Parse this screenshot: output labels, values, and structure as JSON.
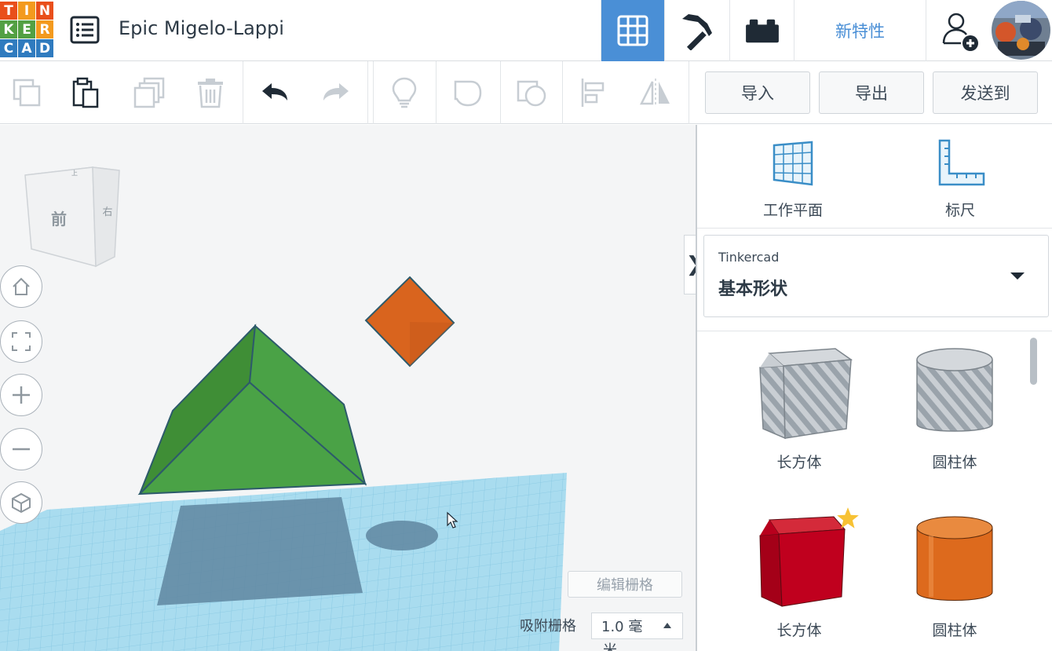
{
  "header": {
    "logo_letters": [
      "T",
      "I",
      "N",
      "K",
      "E",
      "R",
      "C",
      "A",
      "D"
    ],
    "logo_colors": [
      "#e94f1b",
      "#f39a1e",
      "#e94f1b",
      "#52a043",
      "#52a043",
      "#f39a1e",
      "#2f7bbf",
      "#2f7bbf",
      "#2f7bbf"
    ],
    "doc_title": "Epic Migelo-Lappi",
    "whats_new_label": "新特性",
    "tabs": [
      "3d-design-grid",
      "blocks-pickaxe",
      "bricks"
    ]
  },
  "toolbar": {
    "import_label": "导入",
    "export_label": "导出",
    "send_to_label": "发送到"
  },
  "viewport": {
    "view_cube_front": "前",
    "view_cube_right": "右",
    "view_cube_top": "上",
    "edit_grid_label": "编辑栅格",
    "snap_grid_label": "吸附栅格",
    "snap_value": "1.0 毫",
    "snap_value_wrap": "米",
    "collapse_label": "❯"
  },
  "panel": {
    "workplane_label": "工作平面",
    "ruler_label": "标尺",
    "library_source": "Tinkercad",
    "library_name": "基本形状",
    "shapes": [
      {
        "label": "长方体"
      },
      {
        "label": "圆柱体"
      },
      {
        "label": "长方体"
      },
      {
        "label": "圆柱体"
      }
    ]
  },
  "colors": {
    "accent": "#4a8fd6",
    "roof_green": "#4a9e3f",
    "box_orange": "#d9641e",
    "box_red": "#c0001e",
    "cylinder_orange": "#dd6a1d",
    "grid_blue": "#9fd4ea",
    "favorite_star": "#f7c234"
  }
}
